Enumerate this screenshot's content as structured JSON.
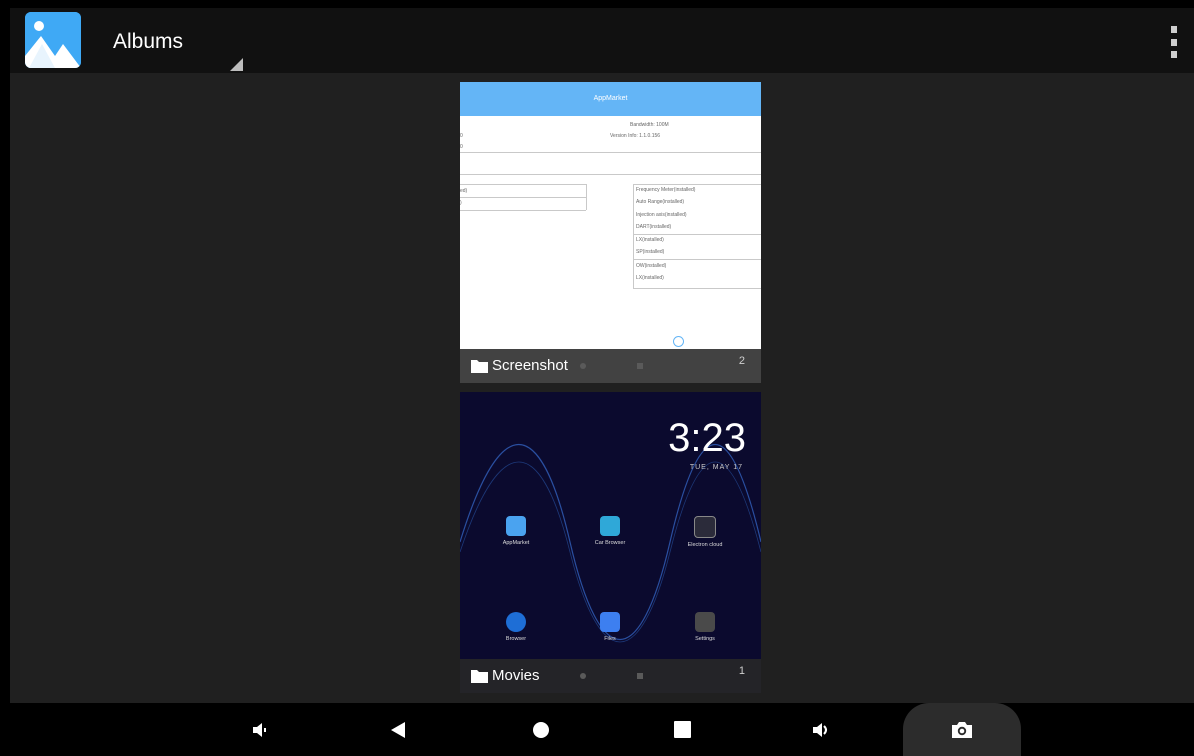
{
  "action_bar": {
    "title": "Albums",
    "app_icon": "gallery-icon",
    "overflow_icon": "more-vert-icon"
  },
  "albums": [
    {
      "name": "Screenshot",
      "count": "2",
      "icon": "folder-icon",
      "thumbnail": {
        "header": "AppMarket",
        "line1": "Bandwidth: 100M",
        "line2": "Version Info: 1.1.0.156",
        "left_a": "ed)",
        "left_b": ")",
        "left_c": "0",
        "left_d": "0",
        "list": [
          "Frequency Meter(installed)",
          "Auto Range(installed)",
          "Injection axis(installed)",
          "DART(installed)",
          "LX(installed)",
          "SP(installed)",
          "OW(installed)",
          "LX(installed)"
        ]
      }
    },
    {
      "name": "Movies",
      "count": "1",
      "icon": "folder-icon",
      "thumbnail": {
        "time": "3:23",
        "date": "TUE, MAY 17",
        "apps": [
          "AppMarket",
          "Car Browser",
          "Electron cloud",
          "Browser",
          "Files",
          "Settings"
        ]
      }
    }
  ],
  "nav_bar": {
    "buttons": [
      "volume-down-icon",
      "back-icon",
      "home-icon",
      "recents-icon",
      "volume-up-icon",
      "camera-icon"
    ]
  },
  "colors": {
    "action_bar": "#111111",
    "content_bg": "#202020",
    "accent_blue": "#64b5f6"
  }
}
